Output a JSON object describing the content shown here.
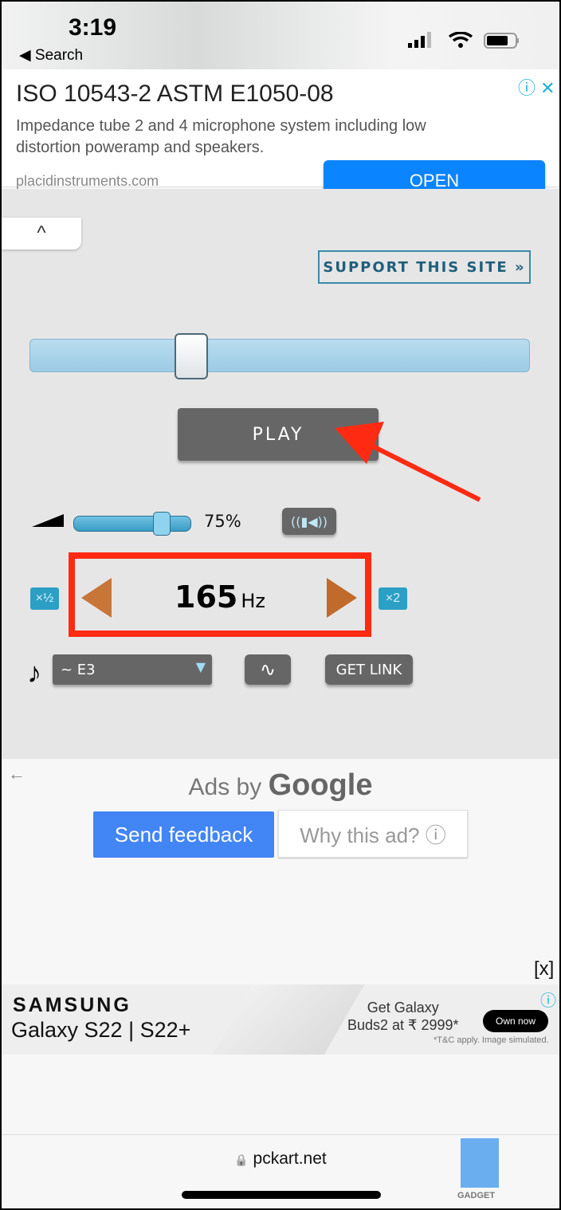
{
  "status_bar": {
    "time": "3:19",
    "back_label": "◀ Search",
    "icons": [
      "cellular-signal-icon",
      "wifi-icon",
      "battery-icon"
    ]
  },
  "top_ad": {
    "title": "ISO 10543-2 ASTM E1050-08",
    "description": "Impedance tube 2 and 4 microphone system including low distortion poweramp and speakers.",
    "domain": "placidinstruments.com",
    "cta": "OPEN",
    "info_icon": "ⓘ",
    "close_icon": "✕"
  },
  "tone_generator": {
    "collapse_icon": "^",
    "support_label": "SUPPORT THIS SITE »",
    "play_label": "PLAY",
    "volume": {
      "value_percent": 75,
      "label": "75%"
    },
    "stereo_icon": "((▮◀))",
    "half_label": "×½",
    "double_label": "×2",
    "frequency": {
      "value": "165",
      "unit": "Hz"
    },
    "note_icon": "♪",
    "note_select": {
      "selected": "~ E3"
    },
    "wave_icon": "∿",
    "get_link_label": "GET LINK",
    "accent_color": "#2c9fc4",
    "highlight_color": "#ff2a12"
  },
  "google_ads": {
    "back_icon": "←",
    "ads_by": "Ads by",
    "google": "Google",
    "send_feedback": "Send feedback",
    "why_this_ad": "Why this ad? ⓘ"
  },
  "banner_ad": {
    "close_label": "[x]",
    "brand": "SAMSUNG",
    "product": "Galaxy S22 | S22+",
    "promo_line1": "Get Galaxy",
    "promo_line2": "Buds2 at ₹ 2999*",
    "cta": "Own now",
    "disclaimer": "*T&C apply. Image simulated.",
    "info_icon": "ⓘ"
  },
  "browser": {
    "url": "pckart.net",
    "lock_icon": "🔒",
    "watermark": "GADGET"
  }
}
